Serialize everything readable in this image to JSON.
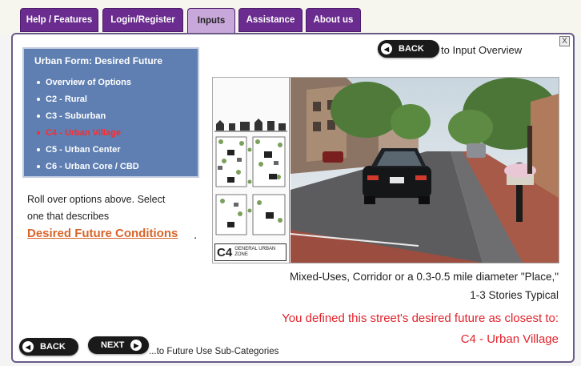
{
  "nav": {
    "tabs": [
      {
        "label": "Help / Features"
      },
      {
        "label": "Login/Register"
      },
      {
        "label": "Inputs"
      },
      {
        "label": "Assistance"
      },
      {
        "label": "About us"
      }
    ],
    "active_tab": "Inputs"
  },
  "panel": {
    "close_label": "X",
    "back_top": {
      "label": "BACK",
      "caption": "to Input Overview"
    },
    "menu": {
      "title": "Urban Form: Desired Future",
      "items": [
        {
          "label": "Overview of Options",
          "selected": false
        },
        {
          "label": "C2 - Rural",
          "selected": false
        },
        {
          "label": "C3 - Suburban",
          "selected": false
        },
        {
          "label": "C4 - Urban Village",
          "selected": true
        },
        {
          "label": "C5 - Urban Center",
          "selected": false
        },
        {
          "label": "C6 - Urban Core / CBD",
          "selected": false
        }
      ]
    },
    "instructions": {
      "line1": "Roll over options above. Select",
      "line2": "one that describes",
      "link": "Desired Future Conditions",
      "trailing": "."
    },
    "image": {
      "diagram_code": "C4",
      "diagram_label_line1": "GENERAL URBAN",
      "diagram_label_line2": "ZONE"
    },
    "caption": {
      "line1": "Mixed-Uses, Corridor or a 0.3-0.5 mile diameter \"Place,\"",
      "line2": "1-3 Stories Typical"
    },
    "result": {
      "line1": "You defined this street's desired future as closest to:",
      "line2": "C4 - Urban Village"
    },
    "footer": {
      "back_label": "BACK",
      "next_label": "NEXT",
      "next_caption": "...to Future Use Sub-Categories"
    }
  },
  "colors": {
    "tab_bg": "#6a2c8e",
    "tab_active_bg": "#c8a8da",
    "menu_bg": "#5f7fb2",
    "selected_item": "#ff2a2a",
    "link": "#d9642a",
    "result_text": "#e3222b"
  },
  "icons": [
    "close-icon",
    "back-arrow-icon",
    "next-arrow-icon"
  ]
}
